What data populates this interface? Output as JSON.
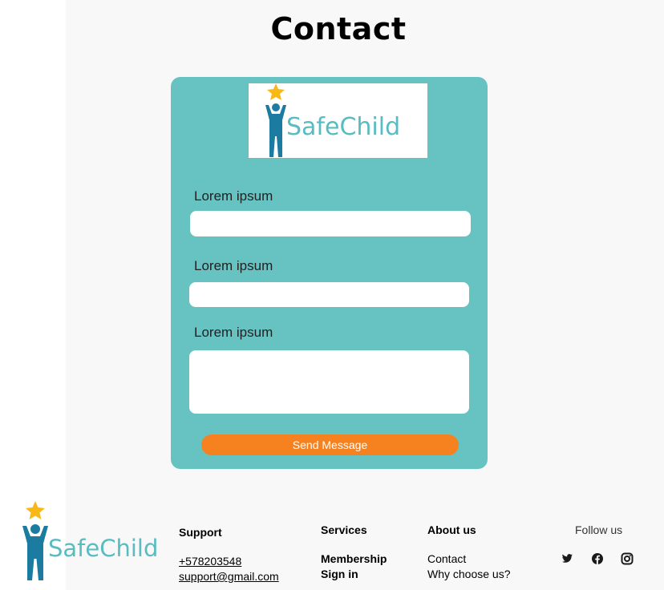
{
  "page": {
    "title": "Contact"
  },
  "logo": {
    "text": "SafeChild"
  },
  "form": {
    "fields": [
      {
        "label": "Lorem ipsum",
        "value": ""
      },
      {
        "label": "Lorem ipsum",
        "value": ""
      },
      {
        "label": "Lorem ipsum",
        "value": ""
      }
    ],
    "submit_label": "Send Message"
  },
  "footer": {
    "logo_text": "SafeChild",
    "support": {
      "heading": "Support",
      "phone": "+578203548",
      "email": "support@gmail.com"
    },
    "services": {
      "heading": "Services",
      "links": [
        "Membership",
        "Sign in"
      ]
    },
    "about": {
      "heading": "About us",
      "links": [
        "Contact",
        "Why choose us?"
      ]
    },
    "follow": {
      "label": "Follow us",
      "icons": [
        "twitter-icon",
        "facebook-icon",
        "instagram-icon"
      ]
    }
  },
  "colors": {
    "card": "#66c3c2",
    "accent": "#f5821f",
    "brand": "#58bcc0",
    "star": "#f7b818",
    "figure": "#1b7ba0"
  }
}
